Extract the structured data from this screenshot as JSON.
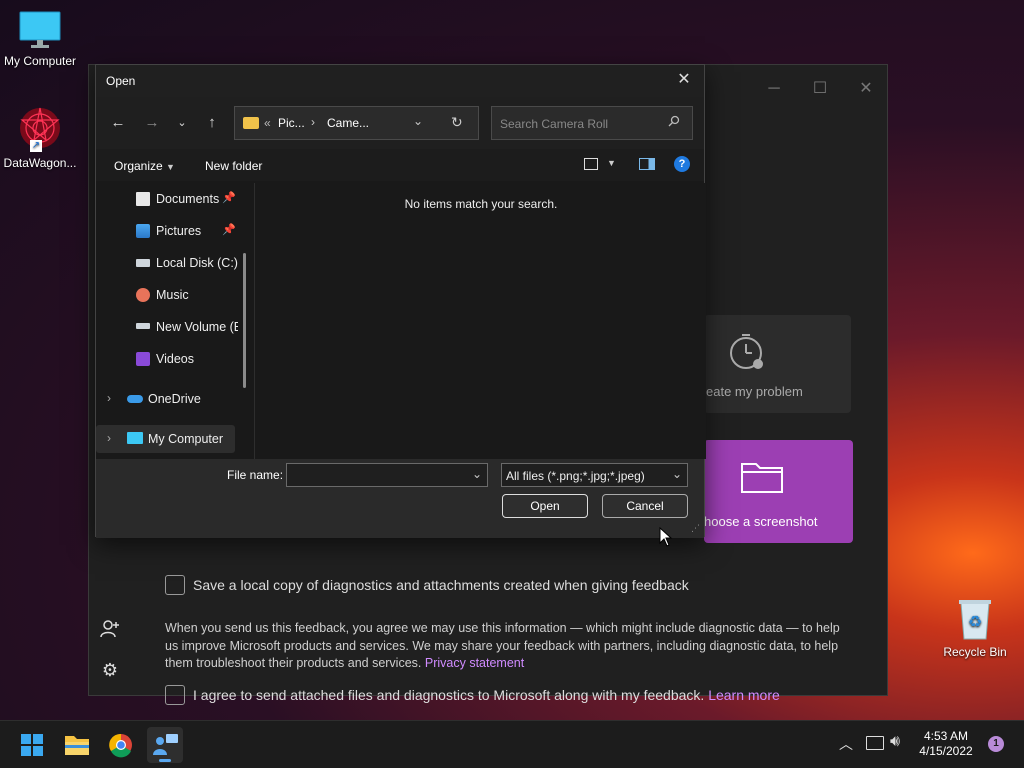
{
  "desktop": {
    "icons": [
      {
        "label": "My Computer"
      },
      {
        "label": "DataWagon..."
      },
      {
        "label": "Recycle Bin"
      }
    ]
  },
  "feedback_window": {
    "tiles": [
      {
        "label": "eate my problem"
      },
      {
        "label": "hoose a screenshot"
      }
    ],
    "save_copy_label": "Save a local copy of diagnostics and attachments created when giving feedback",
    "consent_text": "When you send us this feedback, you agree we may use this information — which might include diagnostic data — to help us improve Microsoft products and services. We may share your feedback with partners, including diagnostic data, to help them troubleshoot their products and services.",
    "privacy_link": "Privacy statement",
    "agree_label": "I agree to send attached files and diagnostics to Microsoft along with my feedback.",
    "learn_more": "Learn more"
  },
  "dialog": {
    "title": "Open",
    "breadcrumb": {
      "prefix": "«",
      "segments": [
        "Pic...",
        "Came..."
      ]
    },
    "search_placeholder": "Search Camera Roll",
    "organize_label": "Organize",
    "new_folder_label": "New folder",
    "nav_items": [
      {
        "label": "Documents",
        "icon": "documents-icon",
        "pinned": true
      },
      {
        "label": "Pictures",
        "icon": "pictures-icon",
        "pinned": true
      },
      {
        "label": "Local Disk (C:)",
        "icon": "drive-icon"
      },
      {
        "label": "Music",
        "icon": "music-icon"
      },
      {
        "label": "New Volume (E",
        "icon": "drive-icon"
      },
      {
        "label": "Videos",
        "icon": "videos-icon"
      },
      {
        "label": "OneDrive",
        "icon": "onedrive-icon"
      },
      {
        "label": "My Computer",
        "icon": "computer-icon"
      }
    ],
    "empty_message": "No items match your search.",
    "file_name_label": "File name:",
    "file_name_value": "",
    "file_type": "All files (*.png;*.jpg;*.jpeg)",
    "open_label": "Open",
    "cancel_label": "Cancel"
  },
  "taskbar": {
    "time": "4:53 AM",
    "date": "4/15/2022",
    "notification_count": "1"
  },
  "colors": {
    "accent_purple": "#9c3fb3",
    "link_purple": "#d08bff",
    "help_blue": "#1f7ae0"
  }
}
